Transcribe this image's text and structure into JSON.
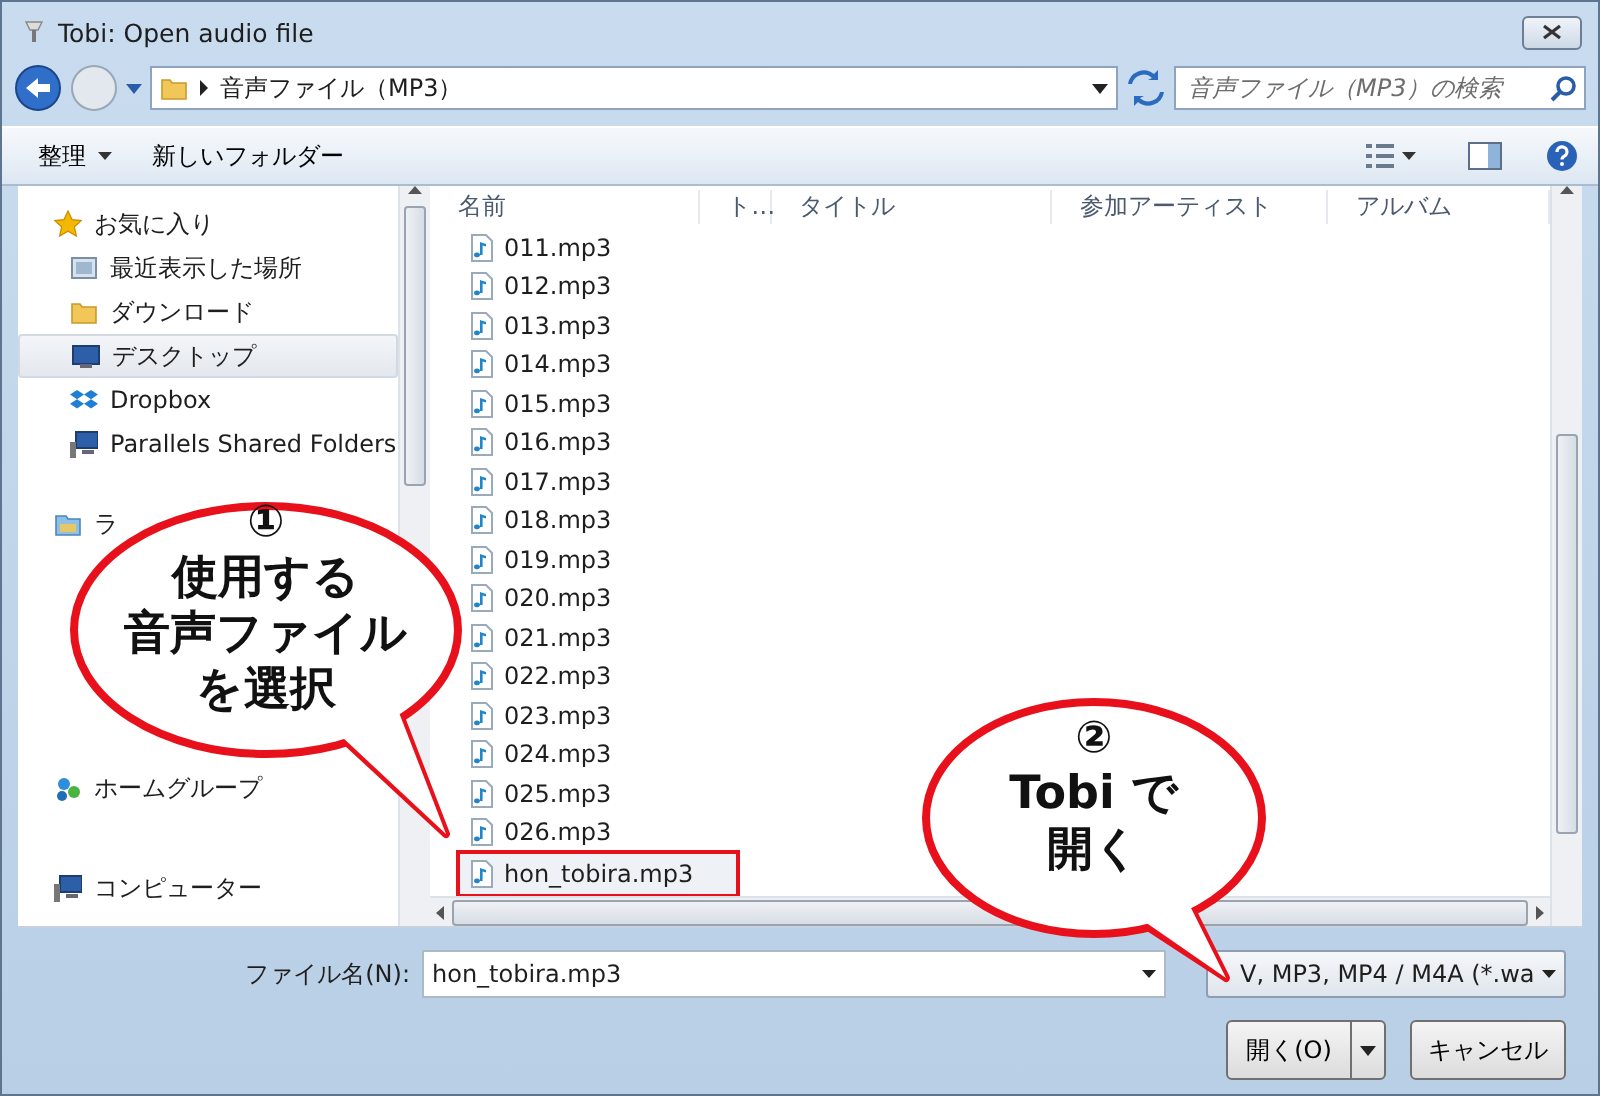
{
  "window": {
    "title": "Tobi: Open audio file"
  },
  "address": {
    "path": "音声ファイル（MP3）",
    "search_placeholder": "音声ファイル（MP3）の検索"
  },
  "toolbar": {
    "organize": "整理",
    "new_folder": "新しいフォルダー"
  },
  "sidebar": [
    {
      "kind": "favorites",
      "label": "お気に入り",
      "items": [
        {
          "kind": "recent",
          "label": "最近表示した場所",
          "selected": false
        },
        {
          "kind": "folder",
          "label": "ダウンロード",
          "selected": false
        },
        {
          "kind": "desktop",
          "label": "デスクトップ",
          "selected": true
        },
        {
          "kind": "dropbox",
          "label": "Dropbox",
          "selected": false
        },
        {
          "kind": "share",
          "label": "Parallels Shared Folders",
          "selected": false
        }
      ]
    },
    {
      "kind": "library",
      "label": "ラ"
    },
    {
      "kind": "homegroup",
      "label": "ホームグループ"
    },
    {
      "kind": "computer",
      "label": "コンピューター"
    }
  ],
  "columns": [
    "名前",
    "ト…",
    "タイトル",
    "参加アーティスト",
    "アルバム"
  ],
  "files": [
    {
      "name": "011.mp3",
      "selected": false
    },
    {
      "name": "012.mp3",
      "selected": false
    },
    {
      "name": "013.mp3",
      "selected": false
    },
    {
      "name": "014.mp3",
      "selected": false
    },
    {
      "name": "015.mp3",
      "selected": false
    },
    {
      "name": "016.mp3",
      "selected": false
    },
    {
      "name": "017.mp3",
      "selected": false
    },
    {
      "name": "018.mp3",
      "selected": false
    },
    {
      "name": "019.mp3",
      "selected": false
    },
    {
      "name": "020.mp3",
      "selected": false
    },
    {
      "name": "021.mp3",
      "selected": false
    },
    {
      "name": "022.mp3",
      "selected": false
    },
    {
      "name": "023.mp3",
      "selected": false
    },
    {
      "name": "024.mp3",
      "selected": false
    },
    {
      "name": "025.mp3",
      "selected": false
    },
    {
      "name": "026.mp3",
      "selected": false
    },
    {
      "name": "hon_tobira.mp3",
      "selected": true
    }
  ],
  "footer": {
    "filename_label": "ファイル名(N):",
    "filename": "hon_tobira.mp3",
    "filetype": "V, MP3, MP4 / M4A (*.wa",
    "open": "開く(O)",
    "cancel": "キャンセル"
  },
  "callouts": [
    {
      "number": "①",
      "lines": [
        "使用する",
        "音声ファイル",
        "を選択"
      ]
    },
    {
      "number": "②",
      "lines": [
        "Tobi で",
        "開く"
      ]
    }
  ]
}
